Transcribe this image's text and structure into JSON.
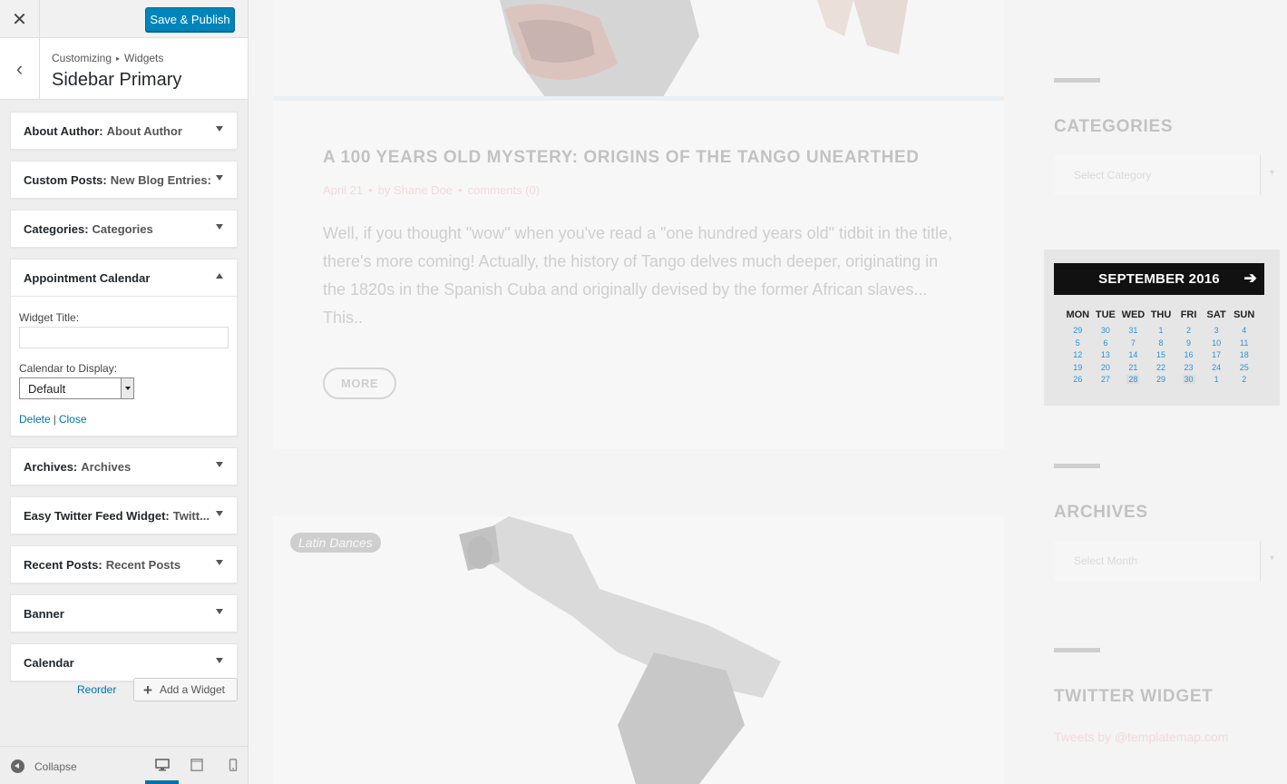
{
  "customizer": {
    "close_icon": "close-icon",
    "save_label": "Save & Publish",
    "breadcrumb_root": "Customizing",
    "breadcrumb_child": "Widgets",
    "section_title": "Sidebar Primary",
    "reorder_label": "Reorder",
    "add_widget_label": "Add a Widget",
    "collapse_label": "Collapse"
  },
  "widgets": [
    {
      "name": "About Author:",
      "subtitle": "About Author"
    },
    {
      "name": "Custom Posts:",
      "subtitle": "New Blog Entries:"
    },
    {
      "name": "Categories:",
      "subtitle": "Categories"
    },
    {
      "name": "Appointment Calendar",
      "subtitle": ""
    },
    {
      "name": "Archives:",
      "subtitle": "Archives"
    },
    {
      "name": "Easy Twitter Feed Widget:",
      "subtitle": "Twitt..."
    },
    {
      "name": "Recent Posts:",
      "subtitle": "Recent Posts"
    },
    {
      "name": "Banner",
      "subtitle": ""
    },
    {
      "name": "Calendar",
      "subtitle": ""
    }
  ],
  "appointment_form": {
    "title_label": "Widget Title:",
    "title_value": "",
    "calendar_label": "Calendar to Display:",
    "calendar_value": "Default",
    "delete_label": "Delete",
    "separator": "|",
    "close_label": "Close"
  },
  "preview": {
    "post_title": "A 100 YEARS OLD MYSTERY: ORIGINS OF THE TANGO UNEARTHED",
    "post_date": "April 21",
    "post_author": "by Shane Doe",
    "post_comments": "comments (0)",
    "post_excerpt": "Well, if you thought \"wow\" when you've read a \"one hundred years old\" tidbit in the title, there's more coming! Actually, the history of Tango delves much deeper, originating in the 1820s in the Spanish Cuba and originally devised by the former African slaves... This..",
    "more_label": "MORE",
    "tag_label": "Latin Dances",
    "categories_heading": "CATEGORIES",
    "categories_select": "Select Category",
    "archives_heading": "ARCHIVES",
    "archives_select": "Select Month",
    "twitter_heading": "TWITTER WIDGET",
    "twitter_text": "Tweets by @templatemap.com"
  },
  "calendar": {
    "month_label": "SEPTEMBER 2016",
    "next_icon": "arrow-right-icon",
    "days_of_week": [
      "MON",
      "TUE",
      "WED",
      "THU",
      "FRI",
      "SAT",
      "SUN"
    ],
    "weeks": [
      [
        "29",
        "30",
        "31",
        "1",
        "2",
        "3",
        "4"
      ],
      [
        "5",
        "6",
        "7",
        "8",
        "9",
        "10",
        "11"
      ],
      [
        "12",
        "13",
        "14",
        "15",
        "16",
        "17",
        "18"
      ],
      [
        "19",
        "20",
        "21",
        "22",
        "23",
        "24",
        "25"
      ],
      [
        "26",
        "27",
        "28",
        "29",
        "30",
        "1",
        "2"
      ]
    ]
  },
  "colors": {
    "primary_button": "#0085ba",
    "link": "#0073aa",
    "calendar_link": "#2a93d8"
  }
}
